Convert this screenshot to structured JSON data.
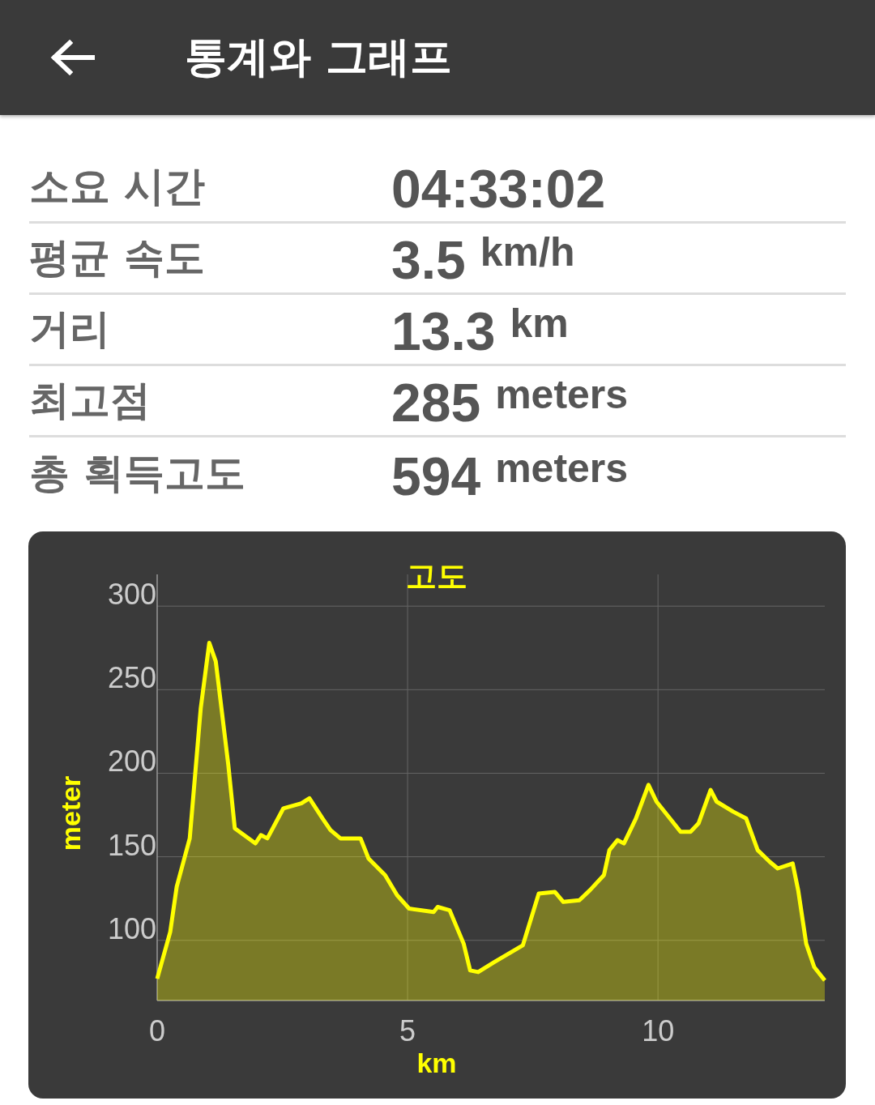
{
  "app_bar": {
    "title": "통계와 그래프"
  },
  "stats": [
    {
      "label": "소요 시간",
      "value": "04:33:02"
    },
    {
      "label": "평균 속도",
      "value": "3.5",
      "unit": "km/h"
    },
    {
      "label": "거리",
      "value": "13.3",
      "unit": "km"
    },
    {
      "label": "최고점",
      "value": "285",
      "unit": "meters"
    },
    {
      "label": "총 획득고도",
      "value": "594",
      "unit": "meters"
    }
  ],
  "elevation_chart": {
    "chart_data": {
      "type": "area",
      "title": "고도",
      "xlabel": "km",
      "ylabel": "meter",
      "x": [
        0,
        0.26,
        0.39,
        0.65,
        0.87,
        1.04,
        1.17,
        1.42,
        1.55,
        1.96,
        2.07,
        2.2,
        2.52,
        2.88,
        3.04,
        3.3,
        3.46,
        3.66,
        4.06,
        4.22,
        4.55,
        4.79,
        5.03,
        5.52,
        5.6,
        5.84,
        6.12,
        6.25,
        6.41,
        6.73,
        7.3,
        7.62,
        7.94,
        8.11,
        8.43,
        8.64,
        8.92,
        9.03,
        9.19,
        9.32,
        9.56,
        9.81,
        9.97,
        10.29,
        10.45,
        10.65,
        10.81,
        11.05,
        11.17,
        11.5,
        11.76,
        11.99,
        12.23,
        12.39,
        12.69,
        12.8,
        12.96,
        13.12,
        13.33
      ],
      "series": [
        {
          "color": "#ffff00",
          "values": [
            77,
            105,
            132,
            161,
            239,
            278,
            267,
            205,
            167,
            158,
            163,
            161,
            179,
            182,
            185,
            173,
            166,
            161,
            161,
            149,
            139,
            127,
            119,
            117,
            120,
            118,
            98,
            82,
            81,
            87,
            97,
            128,
            129,
            123,
            124,
            130,
            139,
            154,
            160,
            158,
            173,
            193,
            183,
            171,
            165,
            165,
            170,
            190,
            183,
            177,
            173,
            154,
            147,
            143,
            146,
            130,
            98,
            84,
            76
          ]
        }
      ],
      "grid": true,
      "xlim": [
        0,
        13.33
      ],
      "ylim": [
        64,
        319
      ],
      "xticks": [
        0,
        5,
        10
      ],
      "yticks": [
        100,
        150,
        200,
        250,
        300
      ]
    }
  }
}
